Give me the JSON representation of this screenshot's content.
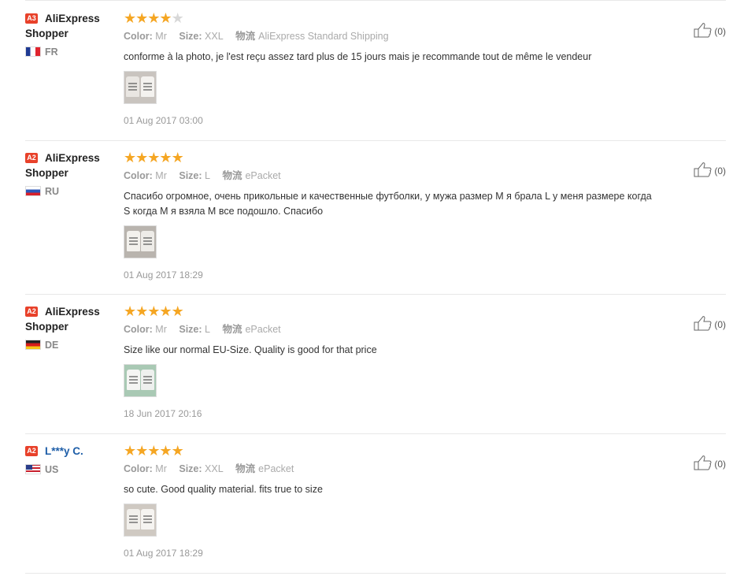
{
  "reviews": [
    {
      "badge": "A3",
      "name_line1": "AliExpress",
      "name_line2": "Shopper",
      "country": "FR",
      "flag_icon": "flag-fr-icon",
      "rating": 4,
      "color_label": "Color:",
      "color_value": "Mr",
      "size_label": "Size:",
      "size_value": "XXL",
      "shipping_label": "物流",
      "shipping_value": "AliExpress Standard Shipping",
      "text": "conforme à la photo, je l'est reçu assez tard plus de 15 jours mais je recommande tout de même le vendeur",
      "date": "01 Aug 2017 03:00",
      "helpful_count": "(0)"
    },
    {
      "badge": "A2",
      "name_line1": "AliExpress",
      "name_line2": "Shopper",
      "country": "RU",
      "flag_icon": "flag-ru-icon",
      "rating": 5,
      "color_label": "Color:",
      "color_value": "Mr",
      "size_label": "Size:",
      "size_value": "L",
      "shipping_label": "物流",
      "shipping_value": "ePacket",
      "text": "Спасибо огромное, очень прикольные и качественные футболки, у мужа размер М я брала L у меня размере когда S когда М я взяла М все подошло. Спасибо",
      "date": "01 Aug 2017 18:29",
      "helpful_count": "(0)"
    },
    {
      "badge": "A2",
      "name_line1": "AliExpress",
      "name_line2": "Shopper",
      "country": "DE",
      "flag_icon": "flag-de-icon",
      "rating": 5,
      "color_label": "Color:",
      "color_value": "Mr",
      "size_label": "Size:",
      "size_value": "L",
      "shipping_label": "物流",
      "shipping_value": "ePacket",
      "text": "Size like our normal EU-Size. Quality is good for that price",
      "date": "18 Jun 2017 20:16",
      "helpful_count": "(0)"
    },
    {
      "badge": "A2",
      "name_line1": "L***y C.",
      "name_line2": "",
      "country": "US",
      "flag_icon": "flag-us-icon",
      "rating": 5,
      "color_label": "Color:",
      "color_value": "Mr",
      "size_label": "Size:",
      "size_value": "XXL",
      "shipping_label": "物流",
      "shipping_value": "ePacket",
      "text": "so cute. Good quality material. fits true to size",
      "date": "01 Aug 2017 18:29",
      "helpful_count": "(0)"
    }
  ],
  "colors": {
    "star": "#f5a623",
    "badge": "#e8412a",
    "link": "#1e5ea8"
  }
}
